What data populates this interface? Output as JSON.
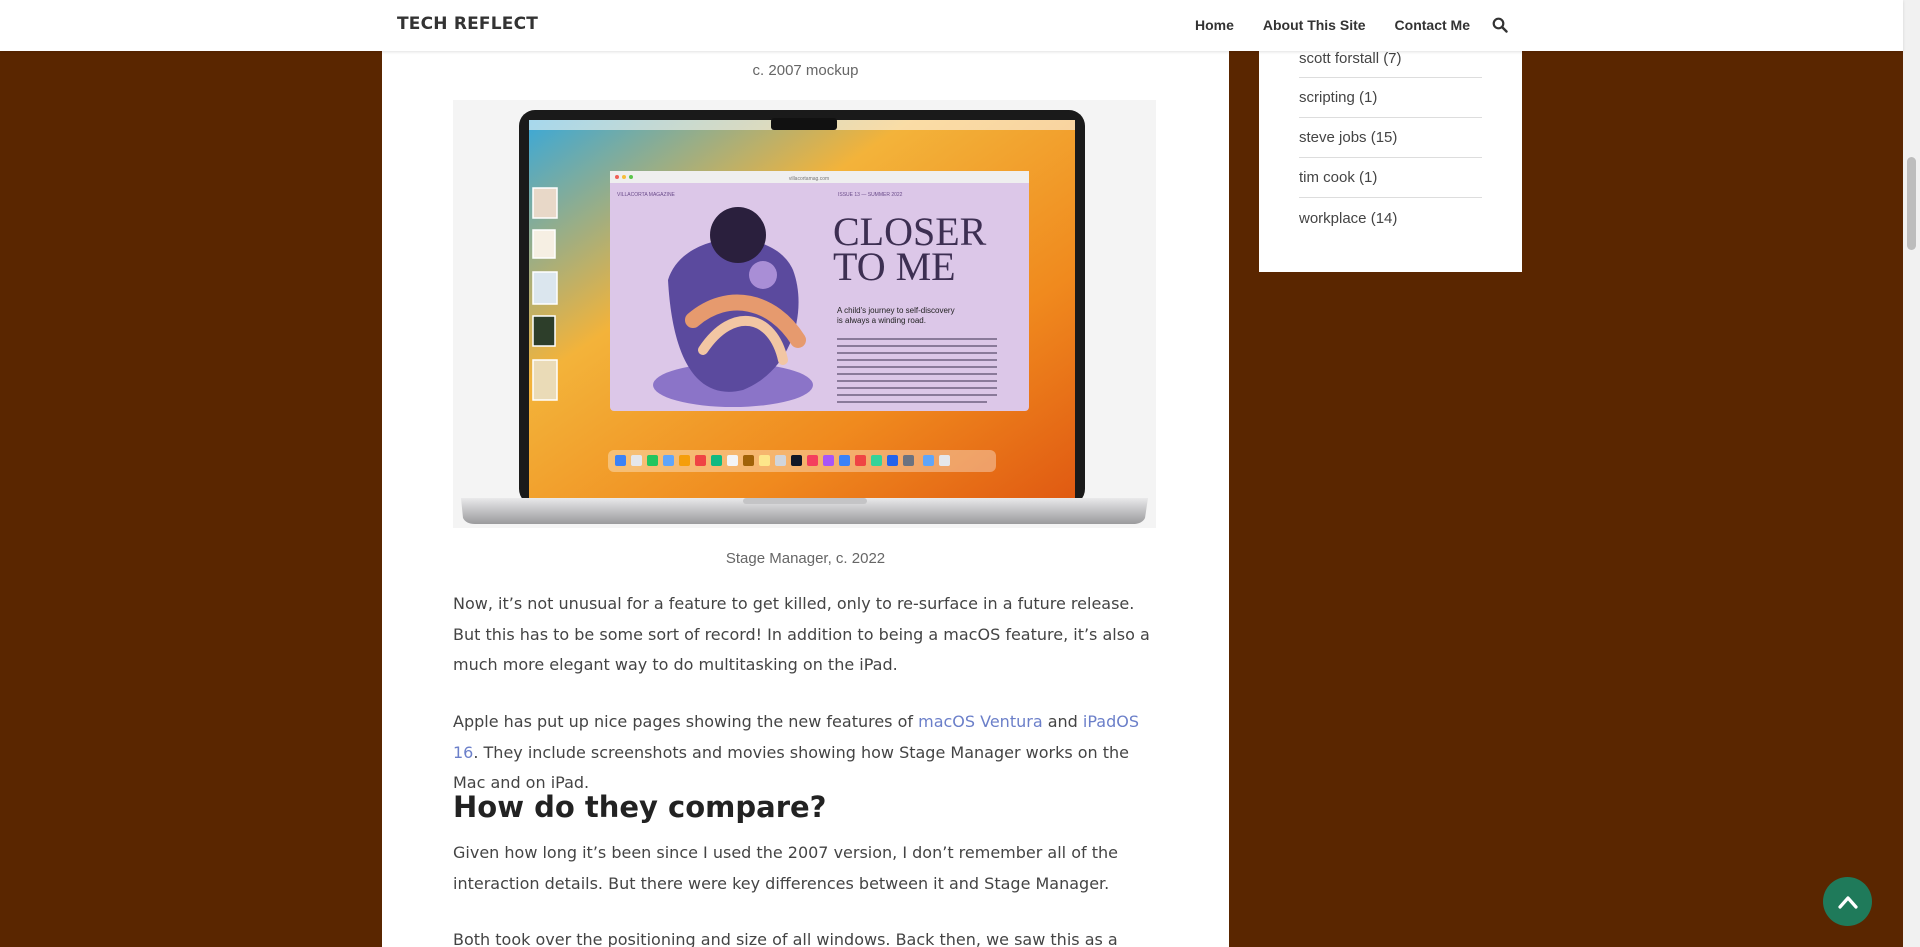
{
  "header": {
    "brand": "TECH REFLECT",
    "nav": [
      "Home",
      "About This Site",
      "Contact Me"
    ],
    "search_icon": "search-icon"
  },
  "article": {
    "caption_top": "c. 2007 mockup",
    "caption_bottom": "Stage Manager, c. 2022",
    "image_texts": {
      "headline": "CLOSER TO ME",
      "subhead": "A child's journey to self-discovery is always a winding road.",
      "magazine": "VILLACORTA MAGAZINE",
      "issue": "ISSUE 13 — SUMMER 2022",
      "url": "villacortamag.com"
    },
    "p1": "Now, it’s not unusual for a feature to get killed, only to re-surface in a future release. But this has to be some sort of record! In addition to being a macOS feature, it’s also a much more elegant way to do multitasking on the iPad.",
    "p2_a": "Apple has put up nice pages showing the new features of ",
    "p2_link1": "macOS Ventura",
    "p2_b": " and ",
    "p2_link2": "iPadOS 16",
    "p2_c": ". They include screenshots and movies showing how Stage Manager works on the Mac and on iPad.",
    "heading": "How do they compare?",
    "p3": "Given how long it’s been since I used the 2007 version, I don’t remember all of the interaction details. But there were key differences between it and Stage Manager.",
    "p4": "Both took over the positioning and size of all windows. Back then, we saw this as a huge win"
  },
  "sidebar": {
    "tags": [
      {
        "label": "scott forstall (7)"
      },
      {
        "label": "scripting (1)"
      },
      {
        "label": "steve jobs (15)"
      },
      {
        "label": "tim cook (1)"
      },
      {
        "label": "workplace (14)"
      }
    ]
  },
  "colors": {
    "background": "#5a2600",
    "link": "#6b7fc9",
    "to_top": "#1f7a5a"
  }
}
